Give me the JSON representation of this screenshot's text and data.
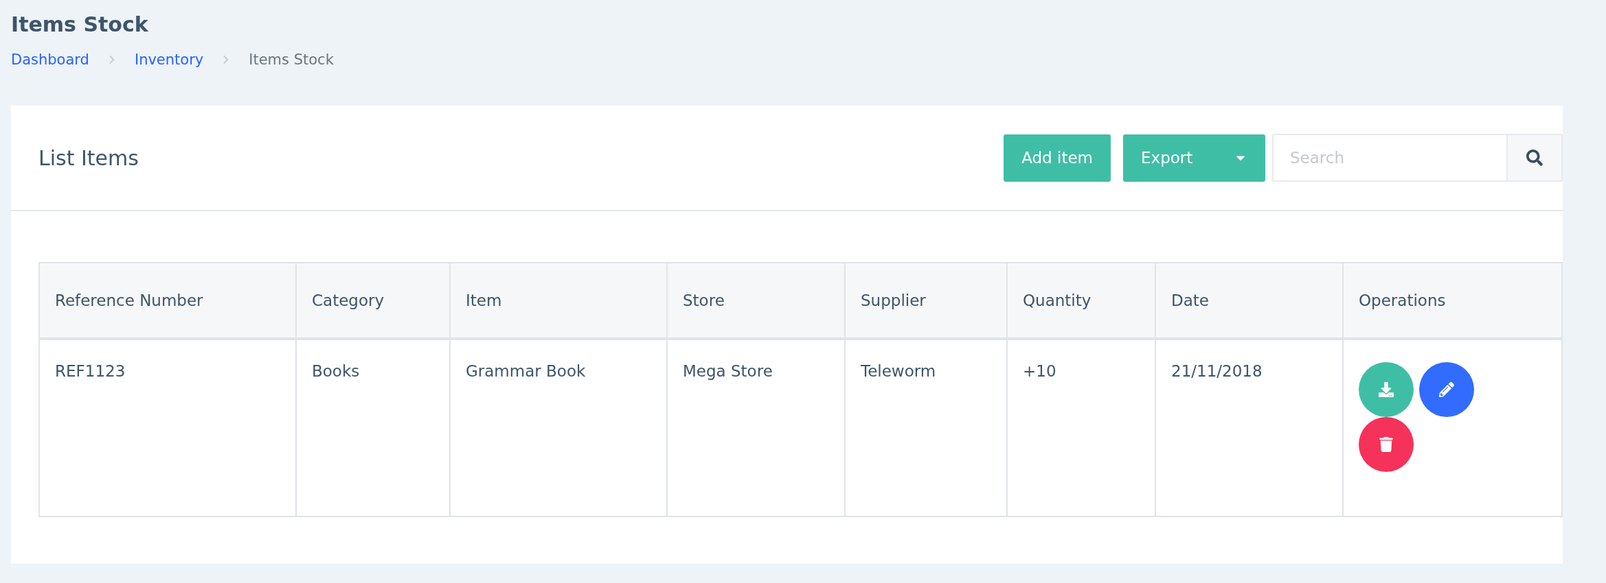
{
  "page": {
    "title": "Items Stock"
  },
  "breadcrumb": [
    {
      "label": "Dashboard",
      "kind": "link"
    },
    {
      "label": "Inventory",
      "kind": "link"
    },
    {
      "label": "Items Stock",
      "kind": "current"
    }
  ],
  "card": {
    "title": "List Items",
    "add_button": "Add item",
    "export_button": "Export",
    "search": {
      "placeholder": "Search"
    }
  },
  "table": {
    "columns": [
      "Reference Number",
      "Category",
      "Item",
      "Store",
      "Supplier",
      "Quantity",
      "Date",
      "Operations"
    ],
    "rows": [
      {
        "cells": [
          "REF1123",
          "Books",
          "Grammar Book",
          "Mega Store",
          "Teleworm",
          "+10",
          "21/11/2018"
        ]
      }
    ]
  }
}
